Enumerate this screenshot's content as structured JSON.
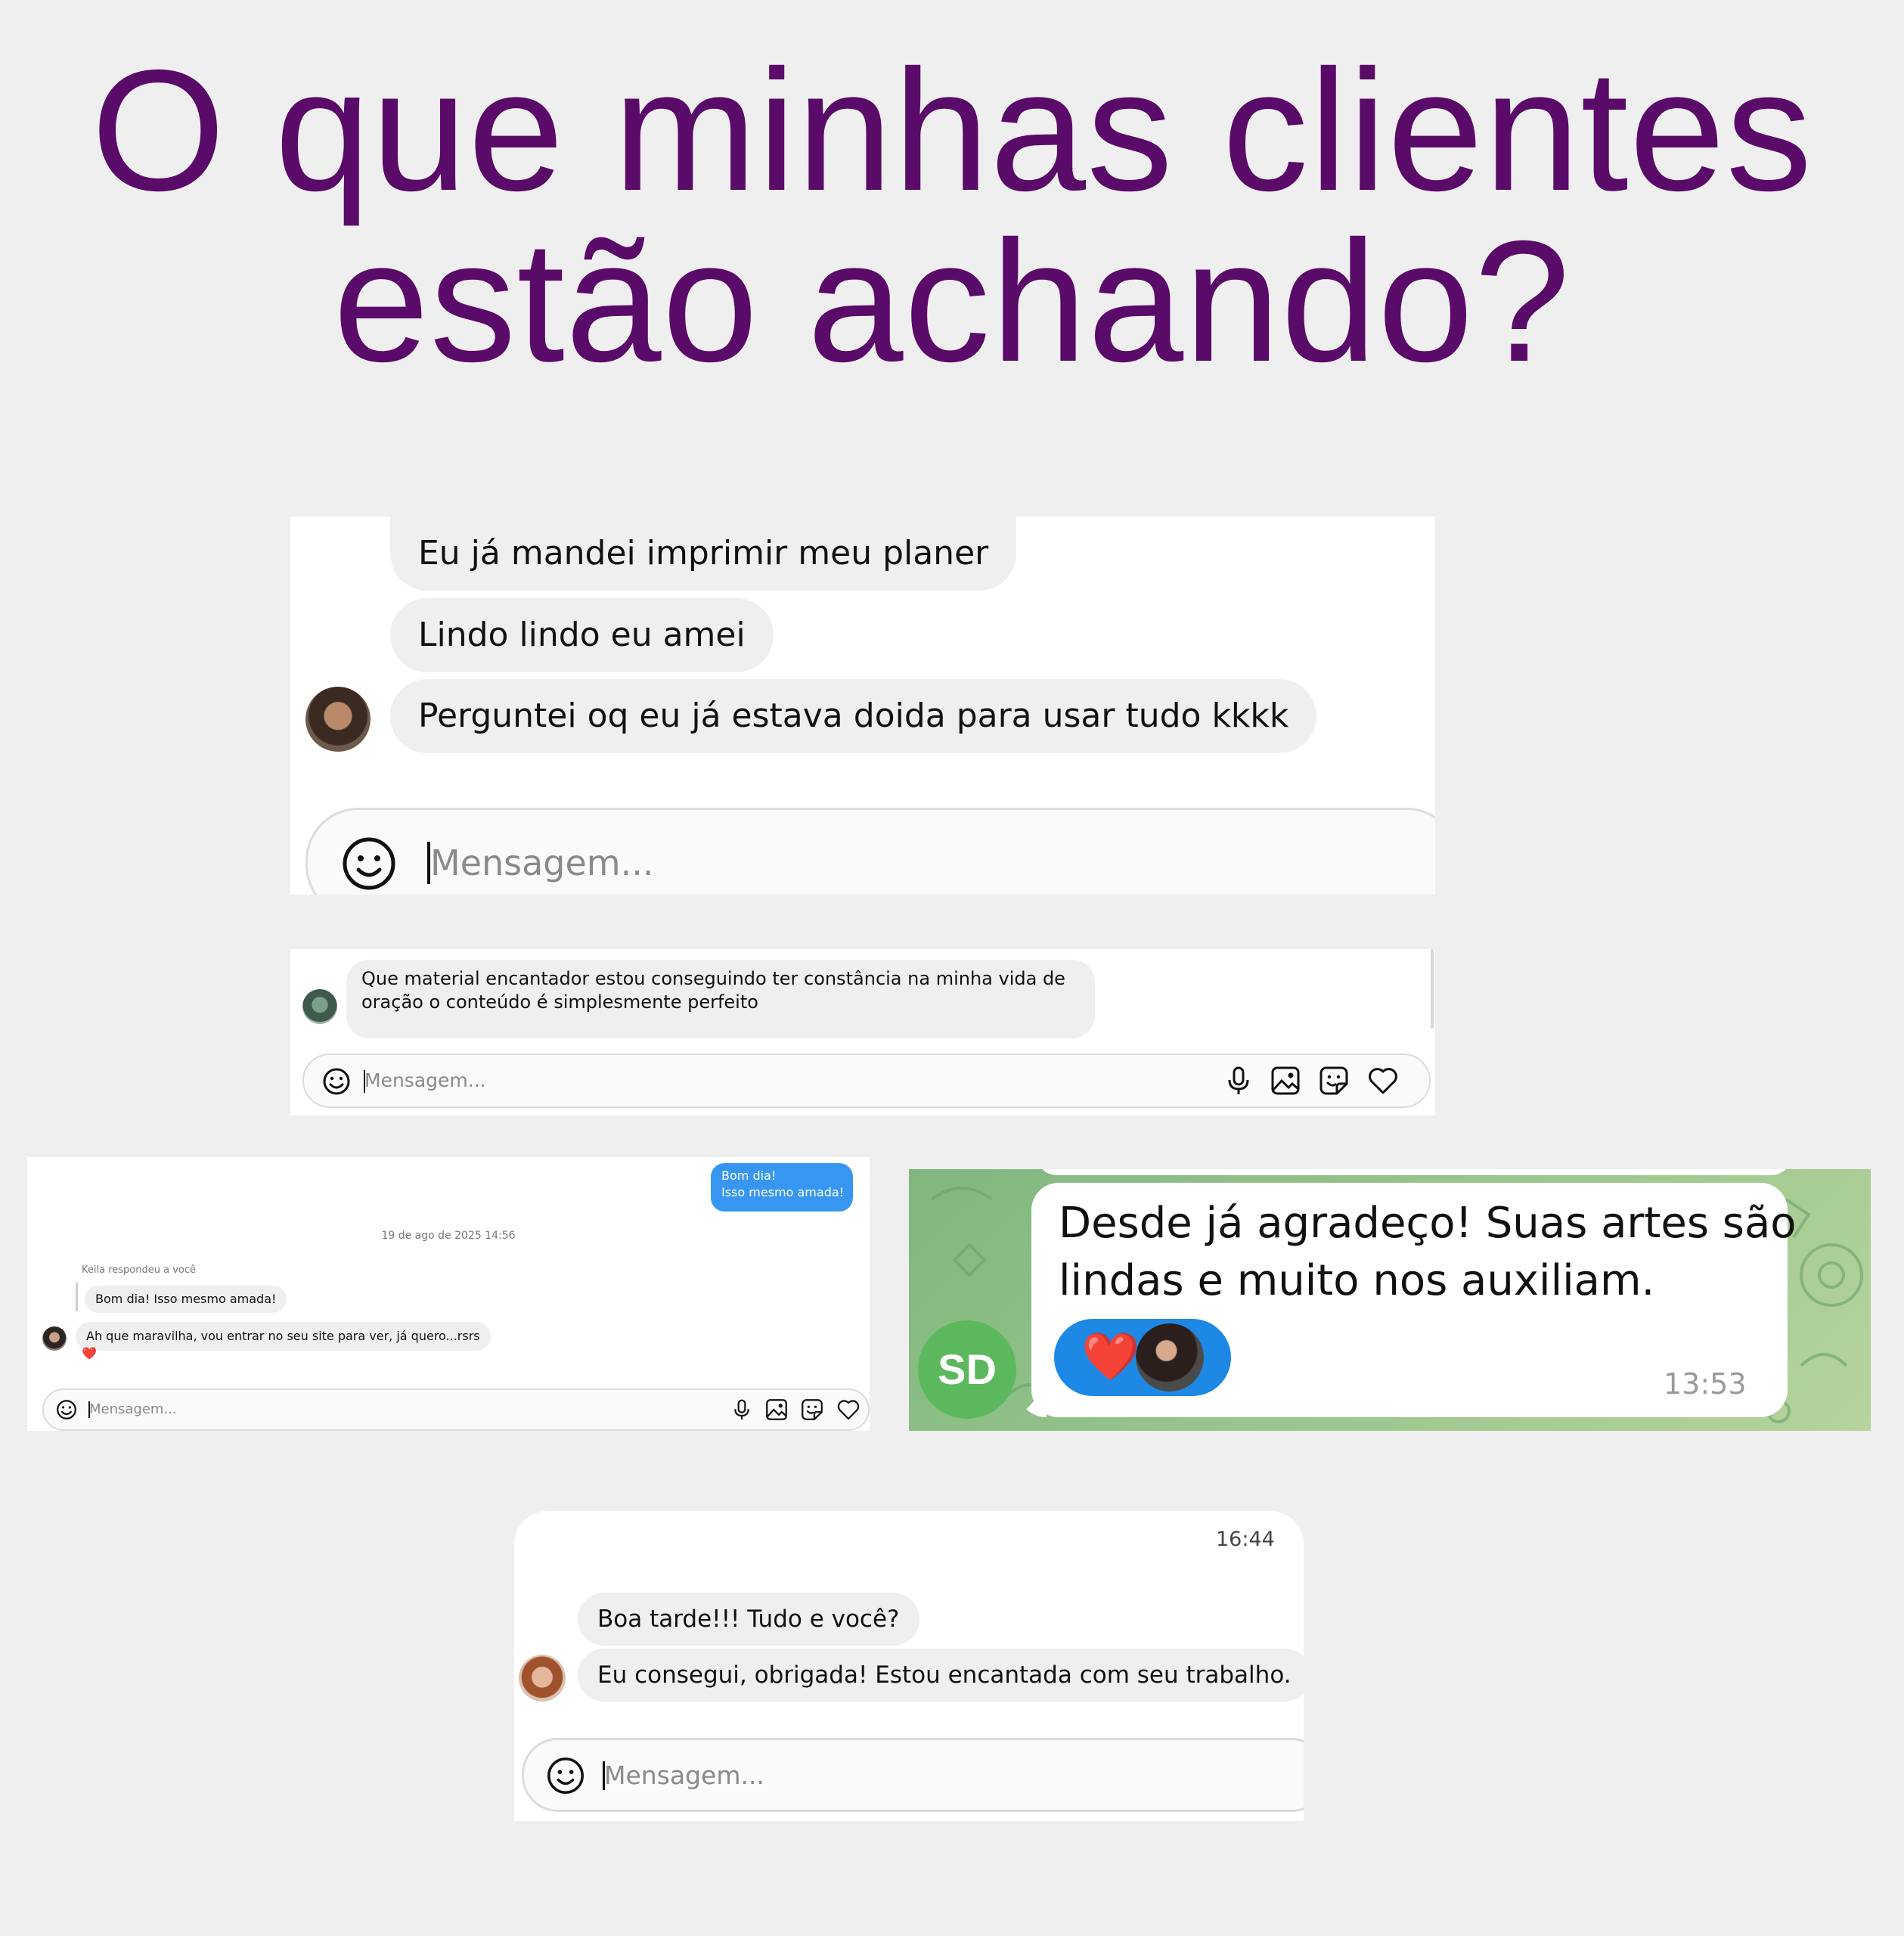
{
  "headline": {
    "line1": "O que minhas clientes",
    "line2": "estão achando?"
  },
  "chat1": {
    "messages": [
      "Eu já mandei imprimir meu planer",
      "Lindo lindo eu amei",
      "Perguntei oq eu já estava doida para usar tudo kkkk"
    ],
    "input_placeholder": "Mensagem..."
  },
  "chat2": {
    "message_line1": "Que material encantador estou conseguindo ter constância na minha vida de",
    "message_line2": "oração o conteúdo é simplesmente perfeito",
    "input_placeholder": "Mensagem...",
    "icons": [
      "microphone-icon",
      "image-icon",
      "sticker-icon",
      "heart-icon"
    ]
  },
  "chat3": {
    "sent_line1": "Bom dia!",
    "sent_line2": "Isso mesmo amada!",
    "date_separator": "19 de ago de 2025 14:56",
    "reply_label": "Keila respondeu a você",
    "quoted_message": "Bom dia! Isso mesmo amada!",
    "message": "Ah que maravilha, vou entrar no seu site para ver, já quero...rsrs",
    "reaction": "❤️",
    "input_placeholder": "Mensagem...",
    "icons": [
      "microphone-icon",
      "image-icon",
      "sticker-icon",
      "heart-icon"
    ]
  },
  "chat4": {
    "avatar_initials": "SD",
    "message_line1": "Desde já agradeço! Suas artes são",
    "message_line2": "lindas e muito nos auxiliam.",
    "reaction": "❤️",
    "time": "13:53",
    "colors": {
      "avatar": "#5cb85c",
      "reaction_pill": "#1e88e5",
      "background": "#8fbf86"
    }
  },
  "chat5": {
    "time": "16:44",
    "messages": [
      "Boa tarde!!! Tudo e você?",
      "Eu consegui, obrigada! Estou encantada com seu trabalho."
    ],
    "input_placeholder": "Mensagem..."
  },
  "colors": {
    "headline": "#5a0a68",
    "page_background": "#efefef",
    "bubble": "#efefef",
    "sent_bubble": "#3797f0"
  }
}
